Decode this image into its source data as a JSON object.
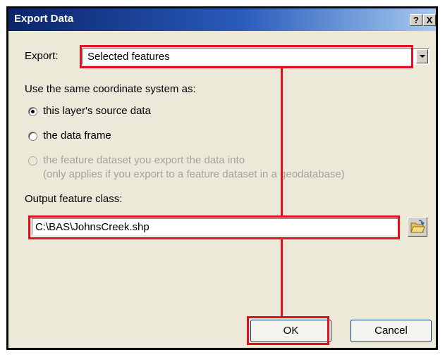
{
  "window": {
    "title": "Export Data",
    "help_glyph": "?",
    "close_glyph": "X"
  },
  "export": {
    "label": "Export:",
    "selected_value": "Selected features"
  },
  "coordinate_system": {
    "heading": "Use the same coordinate system as:",
    "options": [
      {
        "label": "this layer's source data",
        "checked": true,
        "enabled": true
      },
      {
        "label": "the data frame",
        "checked": false,
        "enabled": true
      },
      {
        "label": "the feature dataset you export the data into",
        "checked": false,
        "enabled": false
      }
    ],
    "note": "(only applies if you export to a feature dataset in a geodatabase)"
  },
  "output": {
    "label": "Output feature class:",
    "value": "C:\\BAS\\JohnsCreek.shp",
    "browse_icon": "folder-open-icon"
  },
  "buttons": {
    "ok": "OK",
    "cancel": "Cancel"
  },
  "colors": {
    "highlight": "#e0101e",
    "titlebar_start": "#0a246a",
    "titlebar_end": "#a6caf0",
    "dialog_bg": "#ece9d8"
  }
}
